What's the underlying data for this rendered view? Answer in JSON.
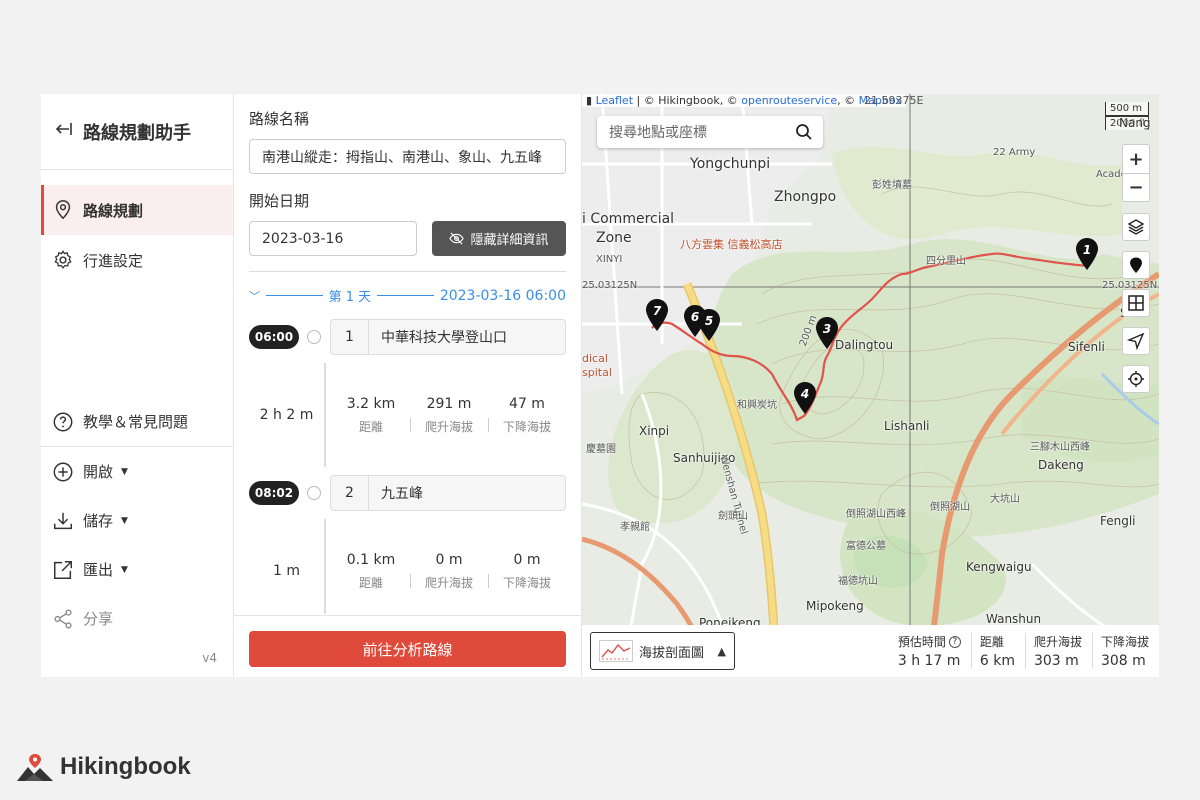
{
  "sidebar": {
    "title": "路線規劃助手",
    "nav": [
      {
        "label": "路線規劃",
        "icon": "map-pin-icon"
      },
      {
        "label": "行進設定",
        "icon": "gear-icon"
      }
    ],
    "help": "教學＆常見問題",
    "menus": [
      {
        "label": "開啟",
        "icon": "plus-circle-icon"
      },
      {
        "label": "儲存",
        "icon": "download-icon"
      },
      {
        "label": "匯出",
        "icon": "external-link-icon"
      }
    ],
    "share": "分享",
    "version": "v4"
  },
  "panel": {
    "route_name_label": "路線名稱",
    "route_name_value": "南港山縱走：拇指山、南港山、象山、九五峰",
    "start_date_label": "開始日期",
    "start_date_value": "2023-03-16",
    "toggle_details_label": "隱藏詳細資訊",
    "day_label": "第 1 天",
    "day_datetime": "2023-03-16  06:00",
    "stops": [
      {
        "time": "06:00",
        "index": "1",
        "name": "中華科技大學登山口"
      },
      {
        "time": "08:02",
        "index": "2",
        "name": "九五峰"
      }
    ],
    "legs": [
      {
        "duration": "2 h 2 m",
        "distance": "3.2 km",
        "ascent": "291 m",
        "descent": "47 m"
      },
      {
        "duration": "1 m",
        "distance": "0.1 km",
        "ascent": "0 m",
        "descent": "0 m"
      }
    ],
    "stat_labels": {
      "distance": "距離",
      "ascent": "爬升海拔",
      "descent": "下降海拔"
    },
    "analyze_button": "前往分析路線"
  },
  "map": {
    "attribution": {
      "leaflet": "Leaflet",
      "sep1": " | © Hikingbook, © ",
      "ors": "openrouteservice",
      "sep2": ", © ",
      "mapbox": "Mapbox"
    },
    "coord_top": "21.59375E",
    "coord_left": "25.03125N",
    "coord_right": "25.03125N",
    "scale": [
      "500 m",
      "2000 ft"
    ],
    "search_placeholder": "搜尋地點或座標",
    "zoom_in": "+",
    "zoom_out": "−",
    "labels": {
      "yongchunpi": "Yongchunpi",
      "zhongpo": "Zhongpo",
      "commercial": "i Commercial",
      "zone": "Zone",
      "xinyi": "XINYI",
      "army": "22 Army",
      "academia": "Acade",
      "nangang": "Nang",
      "bisha": "彭姓墳墓",
      "eightfang": "八方雲集 信義松高店",
      "sifenshan": "四分里山",
      "dalingtou": "Dalingtou",
      "sifenli": "Sifenli",
      "hospital_a": "dical",
      "hospital_b": "spital",
      "hexing": "和興炭坑",
      "lishanli": "Lishanli",
      "xinpi": "Xinpi",
      "sanhuijiao": "Sanhuijiao",
      "wenshan": "Wenshan Tunnel",
      "dakeng": "Dakeng",
      "sanjue": "三腳木山西峰",
      "fuhu": "富德公墓",
      "daokengshan": "大坑山",
      "daohu": "倒照湖山",
      "daohuw": "倒照湖山西峰",
      "jiantoushan": "劍頭山",
      "xiaoqin": "孝親館",
      "kengwaigu": "Kengwaigu",
      "hedeshan": "福德坑山",
      "mipokeng": "Mipokeng",
      "poneikeng": "Poneikeng",
      "wanshun": "Wanshun",
      "fenglai": "Fengli",
      "cemetery": "慶墓園",
      "elev200": "200 m",
      "sheng": "Si"
    },
    "markers": [
      "1",
      "3",
      "4",
      "5",
      "6",
      "7"
    ]
  },
  "footer": {
    "elevation_button": "海拔剖面圖",
    "summary": [
      {
        "label": "預估時間",
        "value": "3 h 17 m",
        "help": "?"
      },
      {
        "label": "距離",
        "value": "6 km"
      },
      {
        "label": "爬升海拔",
        "value": "303 m"
      },
      {
        "label": "下降海拔",
        "value": "308 m"
      }
    ]
  },
  "brand": {
    "name": "Hikingbook"
  },
  "colors": {
    "accent": "#e04a3a",
    "link": "#3a8ee6",
    "route": "#e0534a"
  }
}
